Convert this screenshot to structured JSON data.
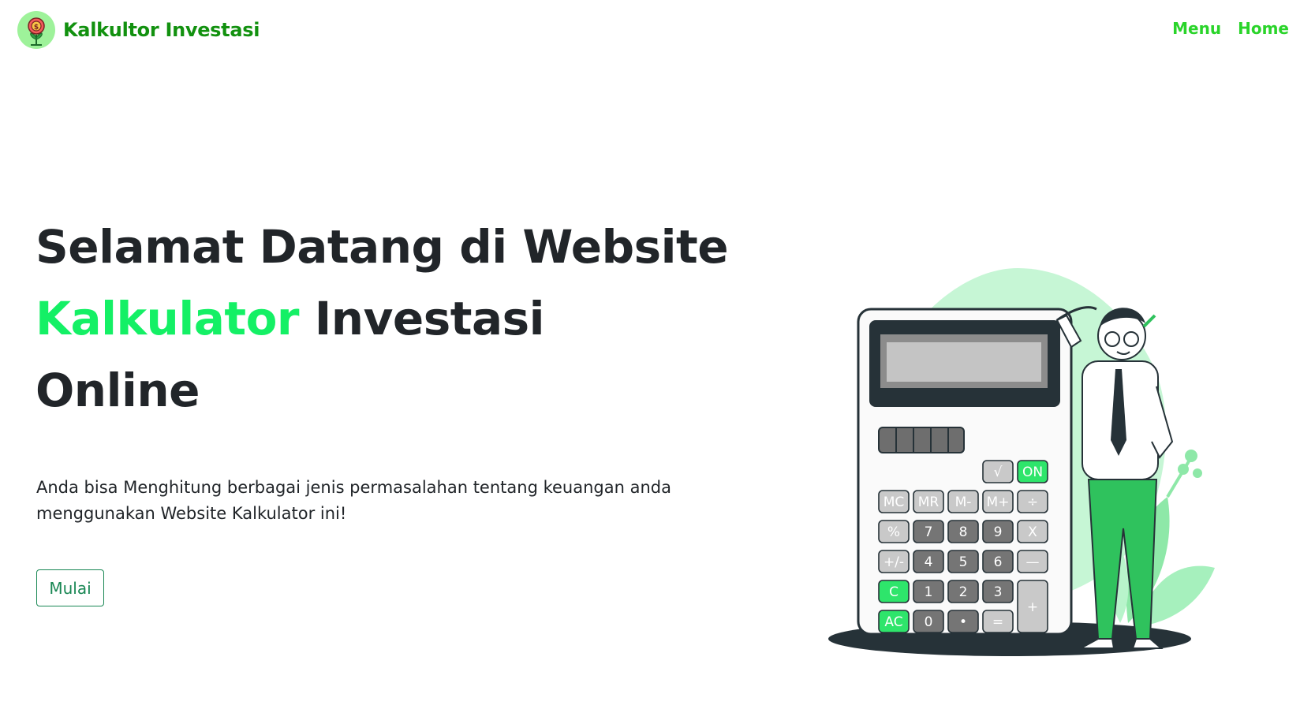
{
  "navbar": {
    "brand_text": "Kalkultor Investasi",
    "links": [
      {
        "label": "Menu"
      },
      {
        "label": "Home"
      }
    ]
  },
  "hero": {
    "title_line1": "Selamat Datang di Website",
    "title_accent": "Kalkulator",
    "title_rest": " Investasi",
    "title_line3": "Online",
    "description": "Anda bisa Menghitung berbagai jenis permasalahan tentang keuangan anda menggunakan Website Kalkulator ini!",
    "button_label": "Mulai"
  },
  "calculator": {
    "rows": [
      [
        "√",
        "ON"
      ],
      [
        "MC",
        "MR",
        "M-",
        "M+",
        "÷"
      ],
      [
        "%",
        "7",
        "8",
        "9",
        "X"
      ],
      [
        "+/-",
        "4",
        "5",
        "6",
        "—"
      ],
      [
        "C",
        "1",
        "2",
        "3",
        "+"
      ],
      [
        "AC",
        "0",
        "•",
        "="
      ]
    ]
  },
  "colors": {
    "brand": "#12910f",
    "nav": "#2ad42a",
    "accent": "#14f065",
    "button": "#198754",
    "text": "#212529"
  }
}
